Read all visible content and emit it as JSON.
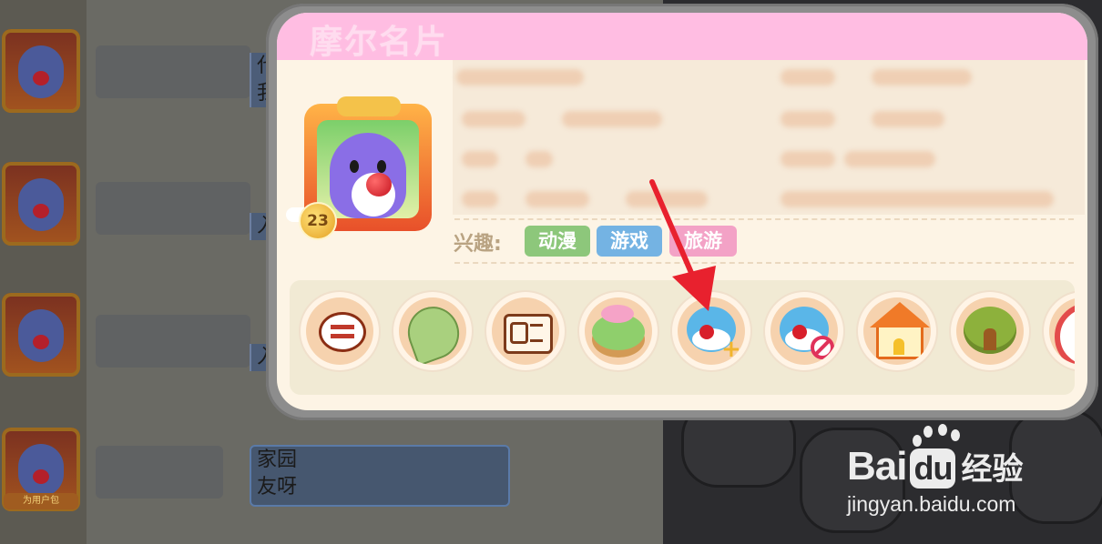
{
  "card": {
    "title": "摩尔名片",
    "level": "23",
    "interests_label": "兴趣:",
    "interests": [
      {
        "label": "动漫",
        "color": "#8dc77b"
      },
      {
        "label": "游戏",
        "color": "#74b3e3"
      },
      {
        "label": "旅游",
        "color": "#f3a2c6"
      }
    ],
    "actions": [
      {
        "icon": "chat-bubble-icon"
      },
      {
        "icon": "leaf-icon"
      },
      {
        "icon": "id-card-icon"
      },
      {
        "icon": "garden-icon"
      },
      {
        "icon": "add-friend-icon"
      },
      {
        "icon": "block-user-icon"
      },
      {
        "icon": "house-icon"
      },
      {
        "icon": "tree-house-icon"
      },
      {
        "icon": "red-ring-icon"
      }
    ]
  },
  "background_chat": {
    "bubble_fragments": [
      "代",
      "我",
      "入",
      "入"
    ],
    "last_message": [
      "家园",
      "友呀"
    ],
    "avatar_tag": "为用户包"
  },
  "watermark": {
    "brand": "Bai",
    "brand_du": "du",
    "brand_suffix": "经验",
    "url": "jingyan.baidu.com"
  },
  "colors": {
    "header_pink": "#ffbde2",
    "card_bg": "#fdf4e5",
    "arrow_red": "#e8212e"
  }
}
